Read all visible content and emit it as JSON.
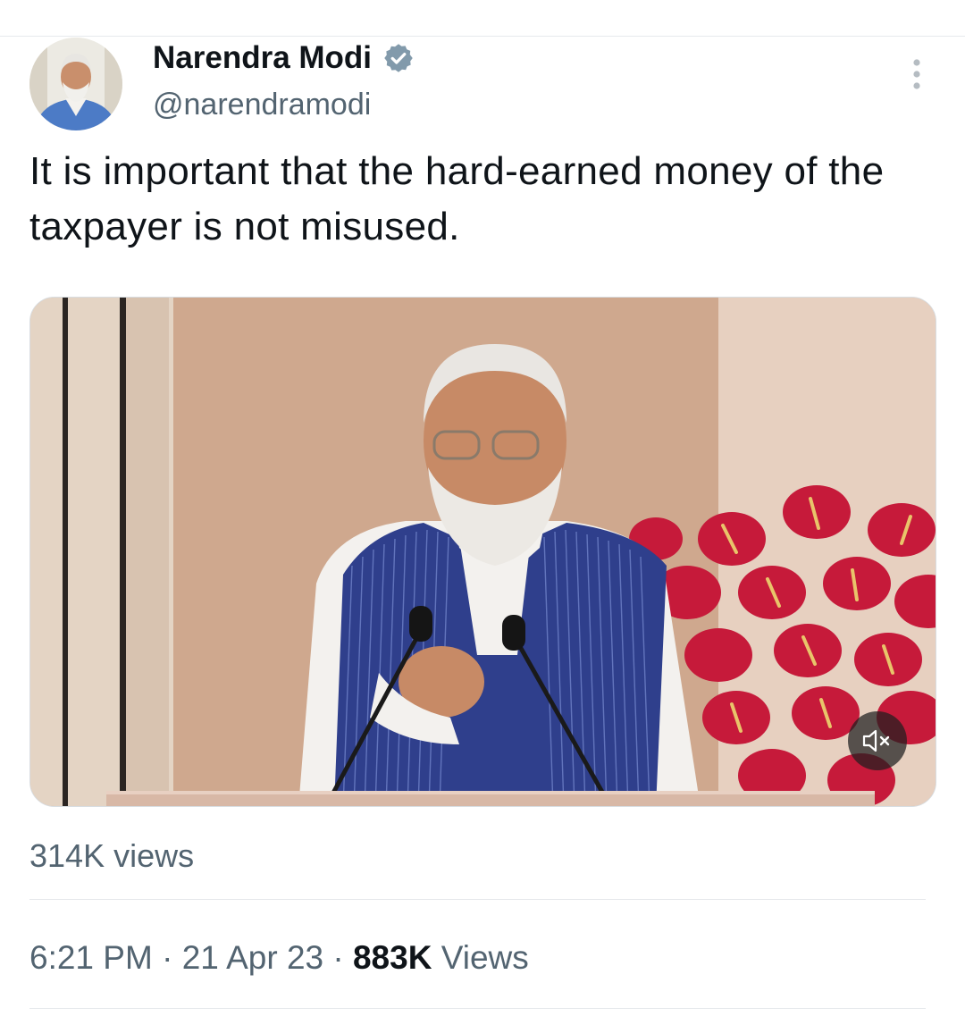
{
  "tweet": {
    "author": {
      "name": "Narendra Modi",
      "handle": "@narendramodi",
      "verified": true
    },
    "text": "It is important that the hard-earned money of the taxpayer is not misused.",
    "media": {
      "type": "video",
      "view_count": "314K views",
      "muted": true
    },
    "meta": {
      "time": "6:21 PM",
      "separator": "·",
      "date": "21 Apr 23",
      "views_count": "883K",
      "views_label": "Views"
    }
  },
  "colors": {
    "text_primary": "#0f1419",
    "text_secondary": "#536471",
    "verified_badge": "#829aab",
    "divider": "#e6e9ec"
  },
  "icons": {
    "verified": "verified-badge-icon",
    "more": "more-vertical-icon",
    "mute": "speaker-muted-icon"
  }
}
